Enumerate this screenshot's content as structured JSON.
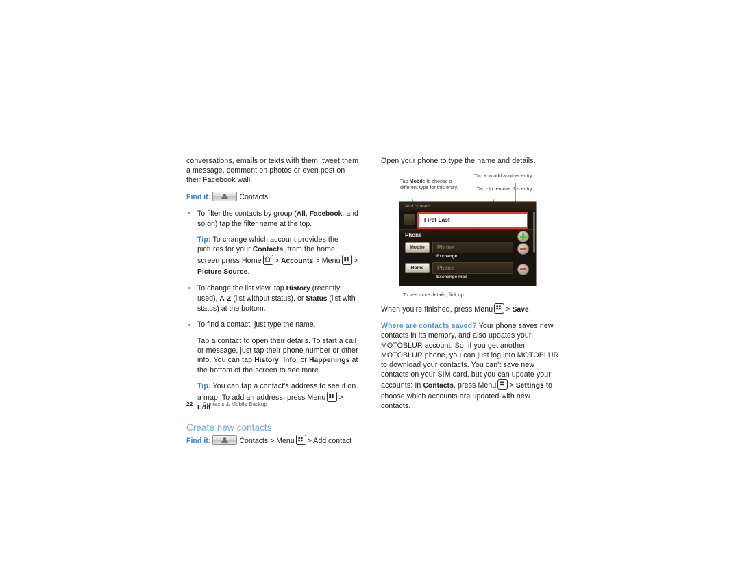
{
  "page": {
    "number": "22",
    "running_head": "Contacts & Mobile Backup"
  },
  "colors": {
    "link_blue": "#3f7fc3",
    "heading_blue": "#72a7de",
    "callout_blue": "#6ba9e2",
    "highlight_red": "#e8392e",
    "plus_green": "#4ec327",
    "minus_red": "#e0382a"
  },
  "left_column": {
    "intro_paragraph": "conversations, emails or texts with them, tweet them a message, comment on photos or even post on their Facebook wall.",
    "find_it": {
      "label": "Find it:",
      "icon": "contacts-icon",
      "target": "Contacts"
    },
    "bullet_filter": {
      "text_before": "To filter the contacts by group (",
      "opt1": "All",
      "sep1": ", ",
      "opt2": "Facebook",
      "text_after": ", and so on) tap the filter name at the top."
    },
    "tip_picture_source": {
      "lead": "Tip:",
      "part1": "To change which account provides the pictures for your",
      "contacts": "Contacts",
      "part2": ", from the home screen press Home",
      "home_icon": "home-key-icon",
      "gt1": ">",
      "accounts": "Accounts",
      "gt2": ">",
      "menu": "Menu",
      "menu_icon": "menu-key-icon",
      "gt3": ">",
      "picture_source": "Picture Source",
      "period": "."
    },
    "bullet_listview": {
      "part1": "To change the list view, tap",
      "history": "History",
      "part2": "(recently used),",
      "az": "A-Z",
      "part3": "(list without status), or",
      "status": "Status",
      "part4": "(list with status) at the bottom."
    },
    "bullet_find": "To find a contact, just type the name.",
    "paragraph_details": {
      "part1": "Tap a contact to open their details. To start a call or message, just tap their phone number or other info. You can tap",
      "history": "History",
      "sep1": ",",
      "info": "Info",
      "sep2": ", or",
      "happenings": "Happenings",
      "part2": "at the bottom of the screen to see more."
    },
    "tip_address": {
      "lead": "Tip:",
      "part1": "You can tap a contact's address to see it on a map. To add an address, press Menu",
      "menu_icon": "menu-key-icon",
      "gt": ">",
      "edit": "Edit",
      "period": "."
    },
    "section_heading": "Create new contacts",
    "find_it2": {
      "label": "Find it:",
      "icon": "contacts-icon",
      "target": "Contacts",
      "gt1": ">",
      "menu": "Menu",
      "menu_icon": "menu-key-icon",
      "gt2": ">",
      "add_contact": "Add contact"
    }
  },
  "right_column": {
    "intro": "Open your phone to type the name and details.",
    "callouts": {
      "type_chooser": {
        "prefix": "Tap",
        "bold": "Mobile",
        "suffix": "to choose a different type for this entry."
      },
      "add_entry": "Tap + to add another entry.",
      "remove_entry": "Tap - to remove this entry.",
      "flick_up": "To see more details, flick up."
    },
    "phone_screen": {
      "title": "Add contact",
      "name_field_value": "First Last",
      "section_label": "Phone",
      "rows": [
        {
          "type": "Mobile",
          "placeholder": "Phone",
          "account": "Exchange"
        },
        {
          "type": "Home",
          "placeholder": "Phone",
          "account": "Exchange mail"
        }
      ],
      "add_button": "+",
      "remove_button": "-"
    },
    "finish_line": {
      "part1": "When you're finished, press Menu",
      "menu_icon": "menu-key-icon",
      "gt": ">",
      "save": "Save",
      "period": "."
    },
    "saved_paragraph": {
      "lead": "Where are contacts saved?",
      "part1": "Your phone saves new contacts in its memory, and also updates your MOTOBLUR account. So, if you get another MOTOBLUR phone, you can just log into MOTOBLUR to download your contacts. You can't save new contacts on your SIM card, but you can update your accounts: In",
      "contacts": "Contacts",
      "part2": ", press Menu",
      "menu_icon": "menu-key-icon",
      "gt": ">",
      "settings": "Settings",
      "part3": "to choose which accounts are updated with new contacts."
    }
  }
}
